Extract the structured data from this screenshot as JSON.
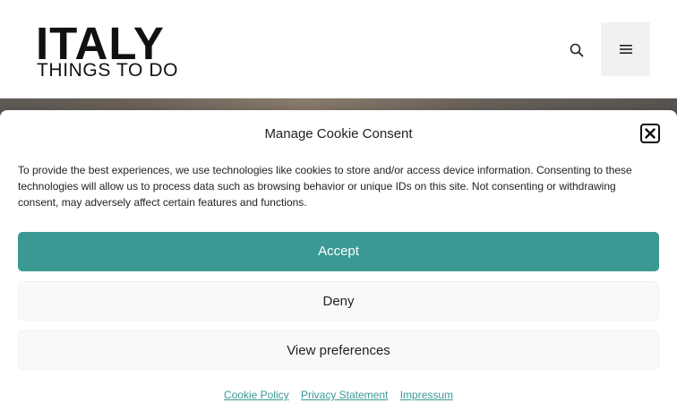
{
  "header": {
    "logo_main": "ITALY",
    "logo_sub": "THINGS TO DO",
    "search_icon": "search-icon",
    "menu_icon": "hamburger-menu-icon"
  },
  "cookie_banner": {
    "title": "Manage Cookie Consent",
    "close_icon": "close-icon",
    "message": "To provide the best experiences, we use technologies like cookies to store and/or access device information. Consenting to these technologies will allow us to process data such as browsing behavior or unique IDs on this site. Not consenting or withdrawing consent, may adversely affect certain features and functions.",
    "accept_label": "Accept",
    "deny_label": "Deny",
    "preferences_label": "View preferences",
    "links": [
      {
        "label": "Cookie Policy"
      },
      {
        "label": "Privacy Statement"
      },
      {
        "label": "Impressum"
      }
    ]
  },
  "colors": {
    "accent": "#3a9a93",
    "button_bg": "#f9f9f9",
    "text": "#222222"
  }
}
